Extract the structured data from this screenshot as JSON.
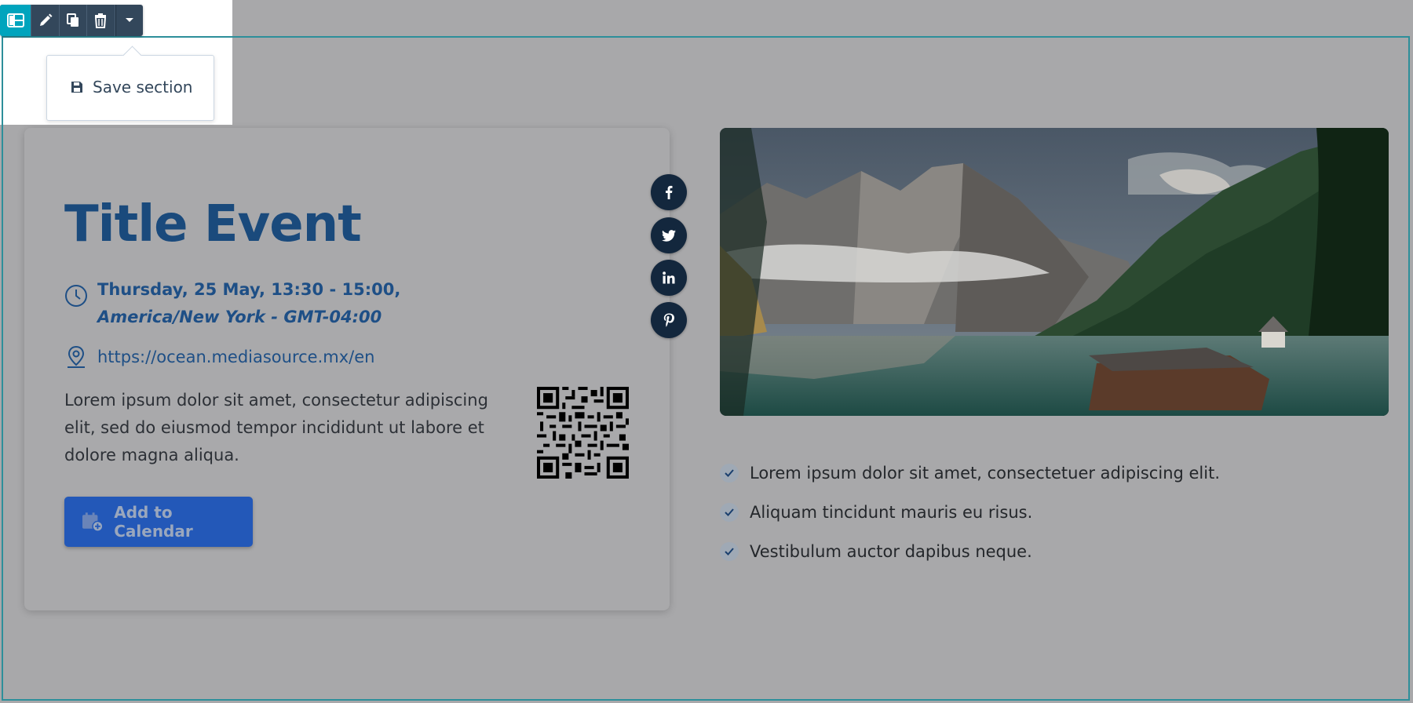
{
  "editor": {
    "toolbar": {
      "icons": [
        "layout-icon",
        "pencil-icon",
        "clone-icon",
        "trash-icon",
        "caret-down-icon"
      ],
      "accent": "#00a4bd",
      "background": "#33475b"
    },
    "dropdown": {
      "save_label": "Save section"
    }
  },
  "event": {
    "title": "Title Event",
    "date": "Thursday, 25 May, 13:30 - 15:00,",
    "timezone": "America/New York - GMT-04:00",
    "url": "https://ocean.mediasource.mx/en",
    "description": "Lorem ipsum dolor sit amet, consectetur adipiscing elit, sed do eiusmod tempor incididunt ut labore et dolore magna aliqua.",
    "calendar_button": "Add to Calendar",
    "title_color": "#1a4a7c",
    "button_color": "#2358b8"
  },
  "social": [
    "facebook-icon",
    "twitter-icon",
    "linkedin-icon",
    "pinterest-icon"
  ],
  "checklist": [
    "Lorem ipsum dolor sit amet, consectetuer adipiscing elit.",
    "Aliquam tincidunt mauris eu risus.",
    "Vestibulum auctor dapibus neque."
  ]
}
